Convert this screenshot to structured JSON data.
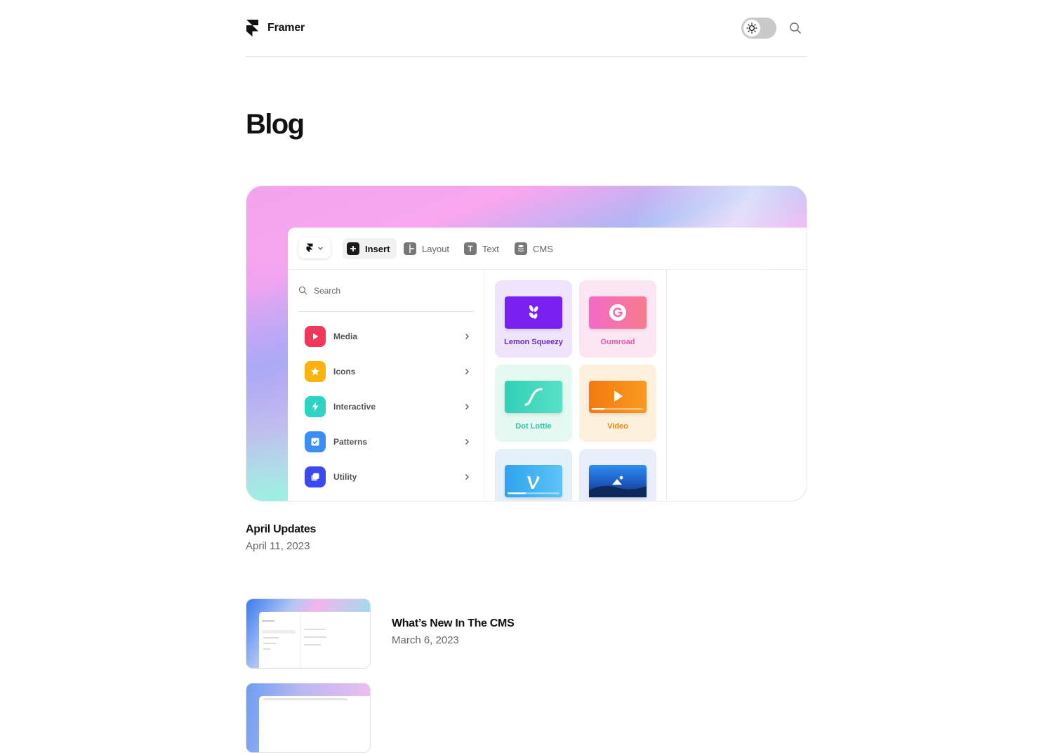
{
  "header": {
    "brand_name": "Framer",
    "icons": [
      "framer-logo-icon",
      "sun-icon",
      "search-icon"
    ]
  },
  "page": {
    "title": "Blog"
  },
  "featured": {
    "toolbar": {
      "insert": "Insert",
      "layout": "Layout",
      "text": "Text",
      "cms": "CMS"
    },
    "search_placeholder": "Search",
    "categories": [
      "Media",
      "Icons",
      "Interactive",
      "Patterns",
      "Utility"
    ],
    "category_colors": [
      "#f2385a",
      "#fbb30c",
      "#2fd3c4",
      "#3c8ef7",
      "#3b49f0"
    ],
    "tiles": [
      "Lemon Squeezy",
      "Gumroad",
      "Dot Lottie",
      "Video"
    ],
    "tile_colors": [
      "#7a1ff2",
      "#ee5db3",
      "#2fd1b6",
      "#f08a14"
    ],
    "title": "April Updates",
    "date": "April 11, 2023"
  },
  "posts": [
    {
      "title": "What’s New In The CMS",
      "date": "March 6, 2023"
    }
  ]
}
